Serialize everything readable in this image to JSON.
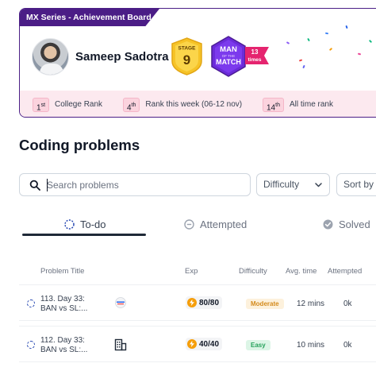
{
  "board": {
    "tag": "MX Series - Achievement Board",
    "user_name": "Sameep Sadotra",
    "stage_badge": {
      "label": "STAGE",
      "value": "9"
    },
    "mom_badge": {
      "line1": "MAN",
      "line2": "OF THE",
      "line3": "MATCH",
      "count": "13",
      "count_label": "times"
    },
    "ranks": [
      {
        "value": "1",
        "suffix": "st",
        "label": "College Rank"
      },
      {
        "value": "4",
        "suffix": "th",
        "label": "Rank this week (06-12 nov)"
      },
      {
        "value": "14",
        "suffix": "th",
        "label": "All time rank"
      }
    ]
  },
  "section_title": "Coding problems",
  "search": {
    "placeholder": "Search problems",
    "value": ""
  },
  "filters": {
    "difficulty": "Difficulty",
    "sort": "Sort by"
  },
  "tabs": [
    {
      "label": "To-do",
      "icon": "dashed-circle-icon",
      "active": true
    },
    {
      "label": "Attempted",
      "icon": "minus-circle-icon",
      "active": false
    },
    {
      "label": "Solved",
      "icon": "check-circle-icon",
      "active": false
    }
  ],
  "table": {
    "headers": {
      "title": "Problem Title",
      "exp": "Exp",
      "difficulty": "Difficulty",
      "avg_time": "Avg. time",
      "attempted": "Attempted"
    },
    "rows": [
      {
        "title_line1": "113. Day 33:",
        "title_line2": "BAN vs SL:...",
        "company_icon": "company-logo-icon",
        "exp": "80/80",
        "difficulty": "Moderate",
        "avg_time": "12 mins",
        "attempted": "0k"
      },
      {
        "title_line1": "112. Day 33:",
        "title_line2": "BAN vs SL:...",
        "company_icon": "building-icon",
        "exp": "40/40",
        "difficulty": "Easy",
        "avg_time": "10 mins",
        "attempted": "0k"
      }
    ]
  },
  "colors": {
    "board_border": "#4b1f86",
    "rank_bar": "#fce9ef",
    "moderate": "#d48a1c",
    "easy": "#24a15a",
    "exp_bolt": "#f59e0b"
  }
}
